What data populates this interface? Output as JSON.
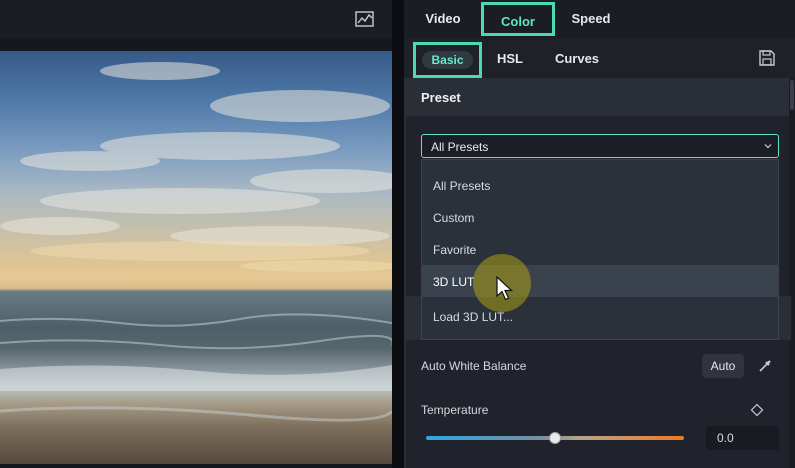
{
  "preview": {
    "scope_icon": "waveform-scope-icon"
  },
  "tabs": {
    "top": [
      {
        "label": "Video"
      },
      {
        "label": "Color"
      },
      {
        "label": "Speed"
      }
    ],
    "active_top": "Color",
    "sub": [
      {
        "label": "Basic"
      },
      {
        "label": "HSL"
      },
      {
        "label": "Curves"
      }
    ],
    "active_sub": "Basic"
  },
  "preset": {
    "section_title": "Preset",
    "selected": "All Presets",
    "options": [
      {
        "label": "All Presets"
      },
      {
        "label": "Custom"
      },
      {
        "label": "Favorite"
      },
      {
        "label": "3D LUT"
      },
      {
        "label": "Load 3D LUT..."
      }
    ],
    "hovered": "3D LUT"
  },
  "white_balance": {
    "label": "Auto White Balance",
    "auto_label": "Auto"
  },
  "temperature": {
    "label": "Temperature",
    "value": "0.0",
    "slider_fraction": 0.5
  },
  "colors": {
    "accent": "#4fd8b4",
    "panel_bg": "#20232b",
    "cursor_highlight": "#aaa014"
  }
}
